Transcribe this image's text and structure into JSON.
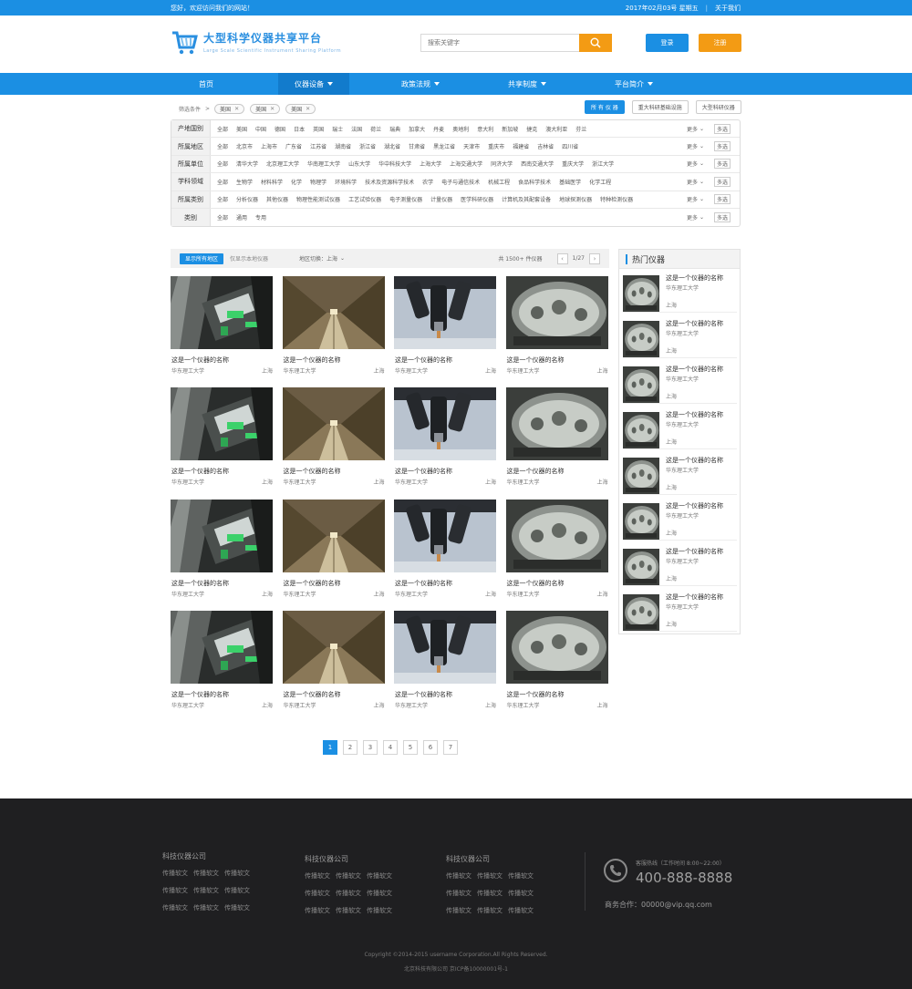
{
  "topbar": {
    "welcome": "您好，欢迎访问我们的网站！",
    "date": "2017年02月03号  星期五",
    "about": "关于我们"
  },
  "header": {
    "logo_title": "大型科学仪器共享平台",
    "logo_sub": "Large Scale Scientific Instrument Sharing Platform",
    "search_placeholder": "搜索关键字",
    "login": "登录",
    "register": "注册"
  },
  "nav": [
    {
      "label": "首页",
      "caret": false
    },
    {
      "label": "仪器设备",
      "caret": true
    },
    {
      "label": "政策法规",
      "caret": true
    },
    {
      "label": "共享制度",
      "caret": true
    },
    {
      "label": "平台简介",
      "caret": true
    }
  ],
  "crumbs": {
    "label": "筛选条件",
    "chips": [
      "美国",
      "美国",
      "美国"
    ]
  },
  "type_tabs": [
    "所 有 仪 器",
    "重大科研基础设施",
    "大型科研仪器"
  ],
  "filters": [
    {
      "label": "产地国别",
      "options": [
        "全部",
        "美国",
        "中国",
        "德国",
        "日本",
        "英国",
        "瑞士",
        "法国",
        "荷兰",
        "瑞典",
        "加拿大",
        "丹麦",
        "奥地利",
        "意大利",
        "新加坡",
        "捷克",
        "澳大利亚",
        "芬兰"
      ]
    },
    {
      "label": "所属地区",
      "options": [
        "全部",
        "北京市",
        "上海市",
        "广东省",
        "江苏省",
        "湖南省",
        "浙江省",
        "湖北省",
        "甘肃省",
        "黑龙江省",
        "天津市",
        "重庆市",
        "福建省",
        "吉林省",
        "四川省"
      ]
    },
    {
      "label": "所属单位",
      "options": [
        "全部",
        "清华大学",
        "北京理工大学",
        "华南理工大学",
        "山东大学",
        "华中科技大学",
        "上海大学",
        "上海交通大学",
        "同济大学",
        "西南交通大学",
        "重庆大学",
        "浙江大学"
      ]
    },
    {
      "label": "学科领域",
      "options": [
        "全部",
        "生物学",
        "材料科学",
        "化学",
        "物理学",
        "环境科学",
        "技术及资源科学技术",
        "农学",
        "电子与通信技术",
        "机械工程",
        "食品科学技术",
        "基础医学",
        "化学工程"
      ]
    },
    {
      "label": "所属类别",
      "options": [
        "全部",
        "分析仪器",
        "其他仪器",
        "物理性能测试仪器",
        "工艺试验仪器",
        "电子测量仪器",
        "计量仪器",
        "医学科研仪器",
        "计算机及其配套设备",
        "地球探测仪器",
        "特种检测仪器"
      ]
    },
    {
      "label": "类别",
      "options": [
        "全部",
        "通用",
        "专用"
      ]
    }
  ],
  "filter_more": "更多",
  "filter_multi": "多选",
  "toolbar": {
    "show_all": "显示所有地区",
    "only_local": "仅显示本地仪器",
    "region": "地区切换：上海",
    "total": "共 1500+ 件仪器",
    "page": "1/27"
  },
  "cards": [
    {
      "title": "这是一个仪器的名称",
      "org": "华东理工大学",
      "city": "上海",
      "img": "machine"
    },
    {
      "title": "这是一个仪器的名称",
      "org": "华东理工大学",
      "city": "上海",
      "img": "tunnel"
    },
    {
      "title": "这是一个仪器的名称",
      "org": "华东理工大学",
      "city": "上海",
      "img": "microscope"
    },
    {
      "title": "这是一个仪器的名称",
      "org": "华东理工大学",
      "city": "上海",
      "img": "chamber"
    },
    {
      "title": "这是一个仪器的名称",
      "org": "华东理工大学",
      "city": "上海",
      "img": "machine"
    },
    {
      "title": "这是一个仪器的名称",
      "org": "华东理工大学",
      "city": "上海",
      "img": "tunnel"
    },
    {
      "title": "这是一个仪器的名称",
      "org": "华东理工大学",
      "city": "上海",
      "img": "microscope"
    },
    {
      "title": "这是一个仪器的名称",
      "org": "华东理工大学",
      "city": "上海",
      "img": "chamber"
    },
    {
      "title": "这是一个仪器的名称",
      "org": "华东理工大学",
      "city": "上海",
      "img": "machine"
    },
    {
      "title": "这是一个仪器的名称",
      "org": "华东理工大学",
      "city": "上海",
      "img": "tunnel"
    },
    {
      "title": "这是一个仪器的名称",
      "org": "华东理工大学",
      "city": "上海",
      "img": "microscope"
    },
    {
      "title": "这是一个仪器的名称",
      "org": "华东理工大学",
      "city": "上海",
      "img": "chamber"
    },
    {
      "title": "这是一个仪器的名称",
      "org": "华东理工大学",
      "city": "上海",
      "img": "machine"
    },
    {
      "title": "这是一个仪器的名称",
      "org": "华东理工大学",
      "city": "上海",
      "img": "tunnel"
    },
    {
      "title": "这是一个仪器的名称",
      "org": "华东理工大学",
      "city": "上海",
      "img": "microscope"
    },
    {
      "title": "这是一个仪器的名称",
      "org": "华东理工大学",
      "city": "上海",
      "img": "chamber"
    }
  ],
  "hot": {
    "title": "热门仪器",
    "items": [
      {
        "name": "这是一个仪器的名称",
        "org": "华东理工大学",
        "city": "上海"
      },
      {
        "name": "这是一个仪器的名称",
        "org": "华东理工大学",
        "city": "上海"
      },
      {
        "name": "这是一个仪器的名称",
        "org": "华东理工大学",
        "city": "上海"
      },
      {
        "name": "这是一个仪器的名称",
        "org": "华东理工大学",
        "city": "上海"
      },
      {
        "name": "这是一个仪器的名称",
        "org": "华东理工大学",
        "city": "上海"
      },
      {
        "name": "这是一个仪器的名称",
        "org": "华东理工大学",
        "city": "上海"
      },
      {
        "name": "这是一个仪器的名称",
        "org": "华东理工大学",
        "city": "上海"
      },
      {
        "name": "这是一个仪器的名称",
        "org": "华东理工大学",
        "city": "上海"
      }
    ]
  },
  "pagination": [
    "1",
    "2",
    "3",
    "4",
    "5",
    "6",
    "7"
  ],
  "footer": {
    "columns": [
      {
        "title": "科技仪器公司",
        "rows": [
          [
            "传播软文",
            "传播软文",
            "传播软文"
          ],
          [
            "传播软文",
            "传播软文",
            "传播软文"
          ],
          [
            "传播软文",
            "传播软文",
            "传播软文"
          ]
        ]
      },
      {
        "title": "科技仪器公司",
        "rows": [
          [
            "传播软文",
            "传播软文",
            "传播软文"
          ],
          [
            "传播软文",
            "传播软文",
            "传播软文"
          ],
          [
            "传播软文",
            "传播软文",
            "传播软文"
          ]
        ]
      },
      {
        "title": "科技仪器公司",
        "rows": [
          [
            "传播软文",
            "传播软文",
            "传播软文"
          ],
          [
            "传播软文",
            "传播软文",
            "传播软文"
          ],
          [
            "传播软文",
            "传播软文",
            "传播软文"
          ]
        ]
      }
    ],
    "hotline_label": "客服热线（工作时间 8:00~22:00）",
    "hotline": "400-888-8888",
    "business": "商务合作：00000@vip.qq.com",
    "copyright": "Copyright ©2014-2015 username Corporation.All Rights Reserved.",
    "icp": "北京科技有限公司  京ICP备10000001号-1"
  },
  "colors": {
    "brand": "#1b8fe3",
    "accent": "#f39b14",
    "footer_bg": "#1f1f21"
  },
  "icons": {
    "search": "search-icon",
    "logo": "cart-logo-icon",
    "phone": "phone-icon"
  }
}
